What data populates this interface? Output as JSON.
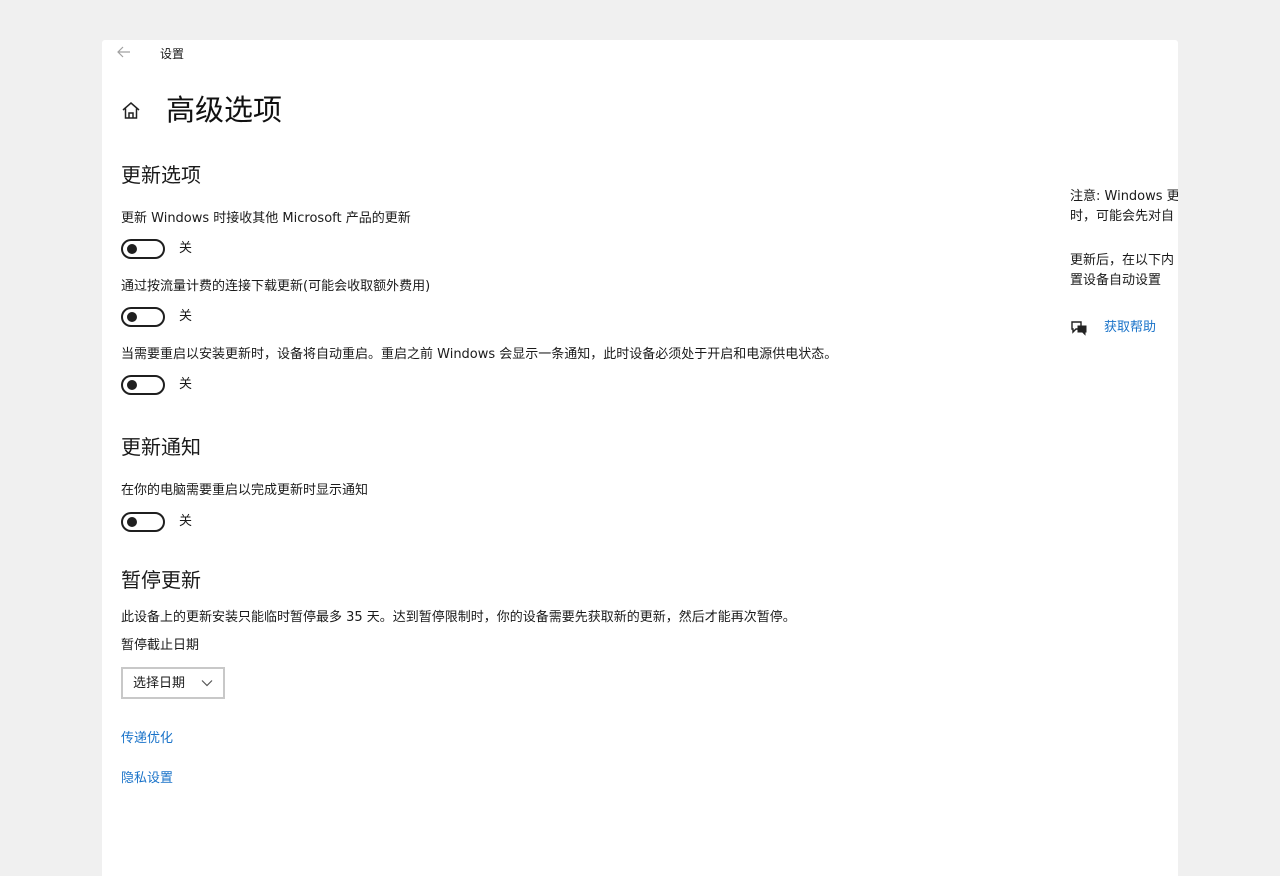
{
  "window": {
    "title": "设置",
    "back_icon": "back-arrow-icon"
  },
  "header": {
    "home_icon": "home-icon",
    "title": "高级选项"
  },
  "update_options": {
    "title": "更新选项",
    "items": [
      {
        "label": "更新 Windows 时接收其他 Microsoft 产品的更新",
        "state": "关",
        "on": false
      },
      {
        "label": "通过按流量计费的连接下载更新(可能会收取额外费用)",
        "state": "关",
        "on": false
      },
      {
        "label": "当需要重启以安装更新时，设备将自动重启。重启之前 Windows 会显示一条通知，此时设备必须处于开启和电源供电状态。",
        "state": "关",
        "on": false
      }
    ]
  },
  "update_notifications": {
    "title": "更新通知",
    "items": [
      {
        "label": "在你的电脑需要重启以完成更新时显示通知",
        "state": "关",
        "on": false
      }
    ]
  },
  "pause_updates": {
    "title": "暂停更新",
    "description": "此设备上的更新安装只能临时暂停最多 35 天。达到暂停限制时，你的设备需要先获取新的更新，然后才能再次暂停。",
    "date_label": "暂停截止日期",
    "date_select": "选择日期"
  },
  "links": {
    "delivery_optimization": "传递优化",
    "privacy_settings": "隐私设置"
  },
  "side_panel": {
    "note_line1": "注意: Windows 更",
    "note_line2": "时，可能会先对自",
    "info_line1": "更新后，在以下内",
    "info_line2": "置设备自动设置",
    "help_icon": "chat-help-icon",
    "help_link": "获取帮助"
  },
  "colors": {
    "link": "#1a73c9",
    "background": "#f0f0f0",
    "window": "#ffffff"
  }
}
